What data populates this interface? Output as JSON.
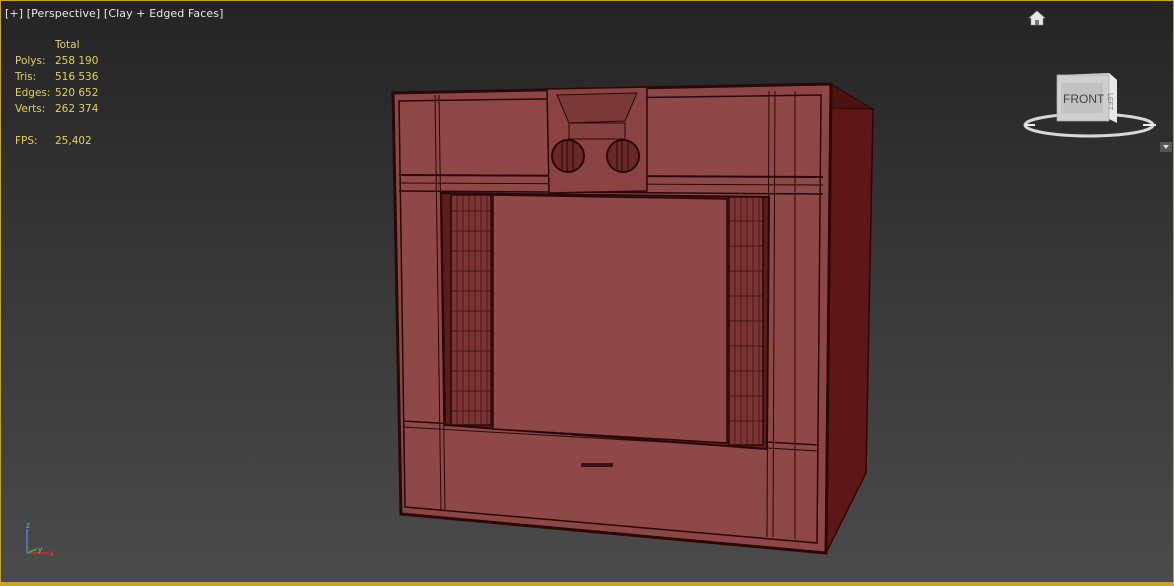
{
  "viewport": {
    "labels": [
      "[+]",
      "[Perspective]",
      "[Clay + Edged Faces]"
    ],
    "stats": {
      "header": "Total",
      "rows": [
        {
          "label": "Polys:",
          "value": "258 190"
        },
        {
          "label": "Tris:",
          "value": "516 536"
        },
        {
          "label": "Edges:",
          "value": "520 652"
        },
        {
          "label": "Verts:",
          "value": "262 374"
        }
      ],
      "fps_label": "FPS:",
      "fps_value": "25,402"
    },
    "viewcube_face": "FRONT",
    "axis": {
      "z": "z",
      "y": "y",
      "x": "x"
    },
    "colors": {
      "accent_border": "#c9a227",
      "stats_text": "#e4cf55",
      "model_face": "#8b4444",
      "wire": "#2a0d0d"
    },
    "icons": [
      "home-icon",
      "viewcube",
      "dropdown-arrow-icon"
    ]
  }
}
